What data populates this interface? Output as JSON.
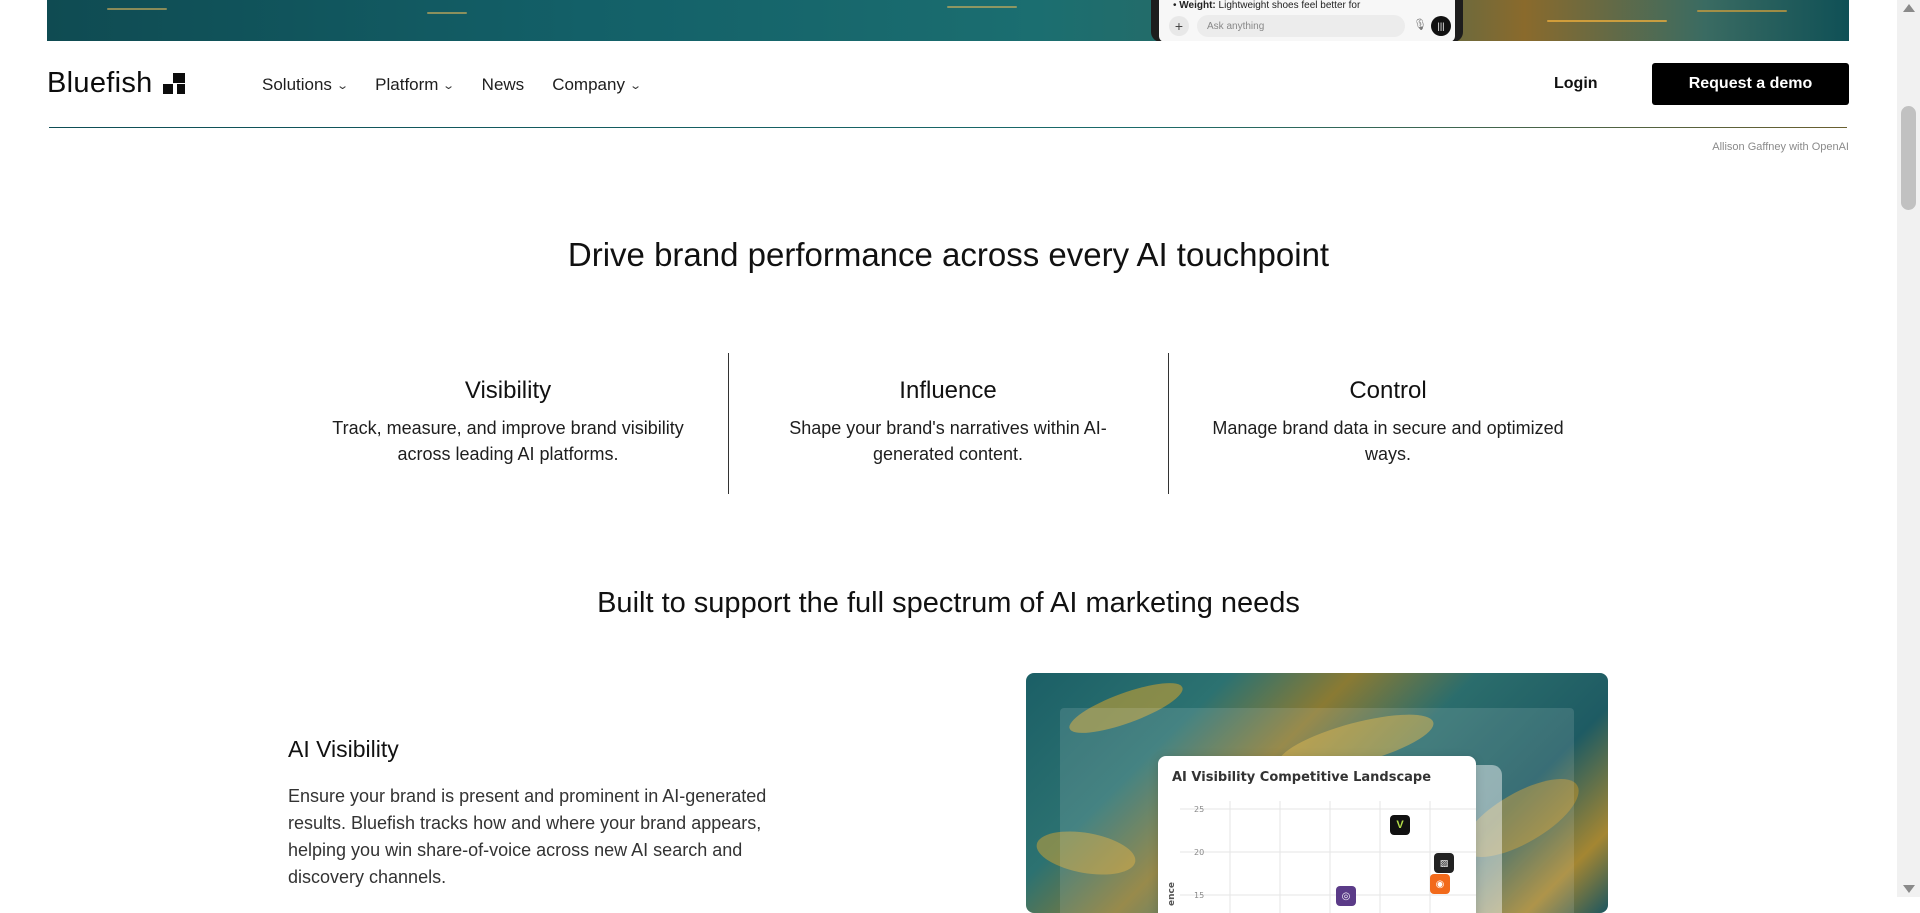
{
  "hero": {
    "phone_text_bold": "Weight:",
    "phone_text": " Lightweight shoes feel better for",
    "ask_placeholder": "Ask anything",
    "plus_icon": "plus-icon",
    "mic_icon": "microphone-icon",
    "voice_icon": "voice-mode-icon"
  },
  "nav": {
    "logo": "Bluefish",
    "menu": [
      {
        "label": "Solutions",
        "has_dropdown": true
      },
      {
        "label": "Platform",
        "has_dropdown": true
      },
      {
        "label": "News",
        "has_dropdown": false
      },
      {
        "label": "Company",
        "has_dropdown": true
      }
    ],
    "chevron": "⌄",
    "login": "Login",
    "demo": "Request a demo"
  },
  "credit": "Allison Gaffney with OpenAI",
  "section1": {
    "title": "Drive brand performance across every AI touchpoint",
    "pillars": [
      {
        "title": "Visibility",
        "text": "Track, measure, and improve brand visibility across leading AI platforms."
      },
      {
        "title": "Influence",
        "text": "Shape your brand's narratives within AI-generated content."
      },
      {
        "title": "Control",
        "text": "Manage brand data in secure and optimized ways."
      }
    ]
  },
  "section2": {
    "title": "Built to support the full spectrum of AI marketing needs",
    "feature": {
      "title": "AI Visibility",
      "text": "Ensure your brand is present and prominent in AI-generated results. Bluefish tracks how and where your brand appears, helping you win share-of-voice across new AI search and discovery channels."
    },
    "card": {
      "title": "AI Visibility Competitive Landscape",
      "y_ticks": [
        "25",
        "20",
        "15"
      ],
      "y_axis_partial": "ence"
    }
  },
  "colors": {
    "accent_teal": "#0e4d55",
    "button_black": "#000000"
  }
}
